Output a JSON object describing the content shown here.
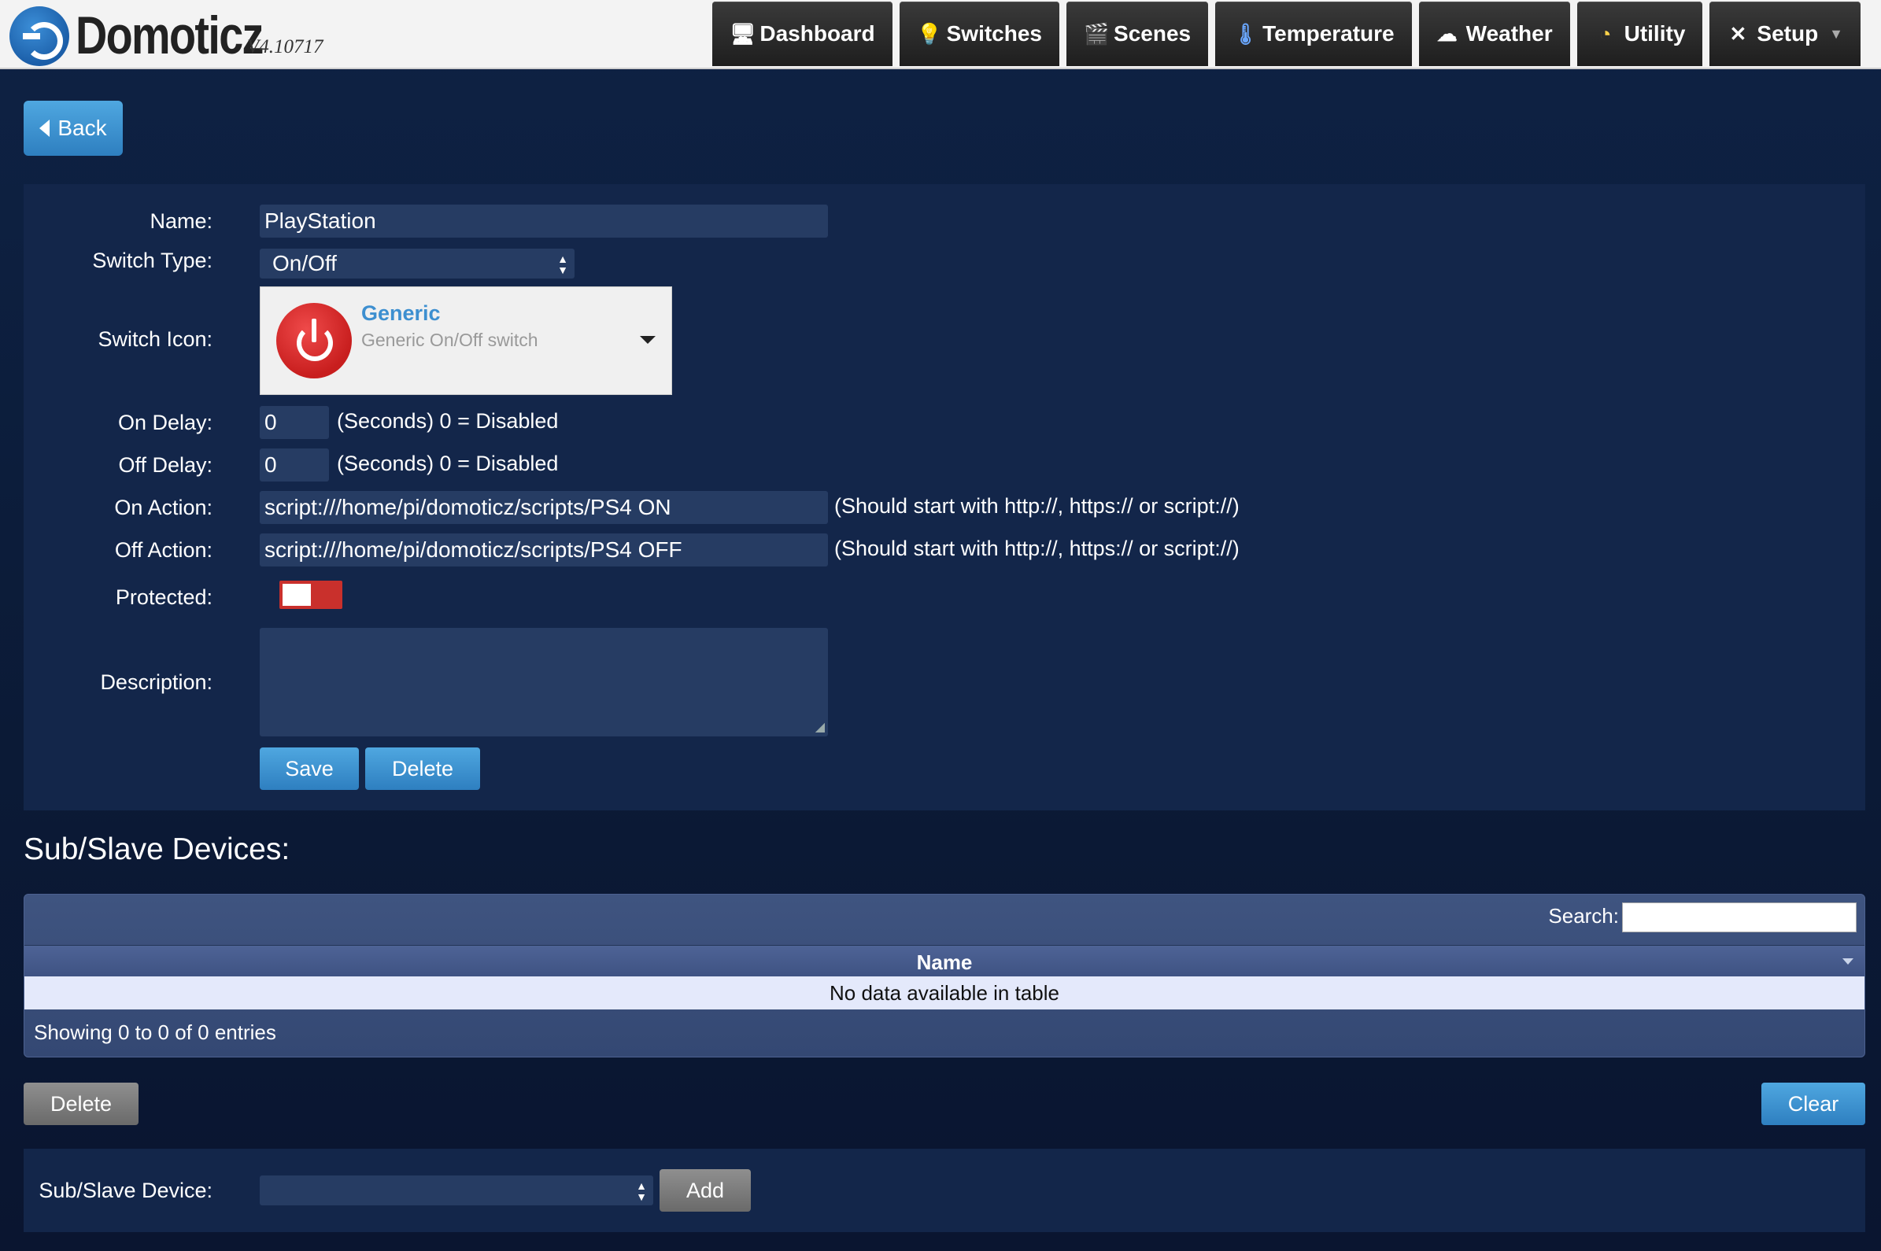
{
  "app": {
    "name": "Domoticz",
    "version": "V4.10717"
  },
  "nav": [
    {
      "label": "Dashboard",
      "icon": "monitor-icon"
    },
    {
      "label": "Switches",
      "icon": "bulb-icon"
    },
    {
      "label": "Scenes",
      "icon": "clapper-icon"
    },
    {
      "label": "Temperature",
      "icon": "thermometer-icon"
    },
    {
      "label": "Weather",
      "icon": "cloud-icon"
    },
    {
      "label": "Utility",
      "icon": "gauge-icon"
    },
    {
      "label": "Setup",
      "icon": "tools-icon"
    }
  ],
  "back_label": "Back",
  "form": {
    "name_label": "Name:",
    "name_value": "PlayStation",
    "switch_type_label": "Switch Type:",
    "switch_type_value": "On/Off",
    "switch_icon_label": "Switch Icon:",
    "icon_title": "Generic",
    "icon_subtitle": "Generic On/Off switch",
    "on_delay_label": "On Delay:",
    "on_delay_value": "0",
    "on_delay_hint": "(Seconds) 0 = Disabled",
    "off_delay_label": "Off Delay:",
    "off_delay_value": "0",
    "off_delay_hint": "(Seconds) 0 = Disabled",
    "on_action_label": "On Action:",
    "on_action_value": "script:///home/pi/domoticz/scripts/PS4 ON",
    "on_action_hint": "(Should start with http://, https:// or script://)",
    "off_action_label": "Off Action:",
    "off_action_value": "script:///home/pi/domoticz/scripts/PS4 OFF",
    "off_action_hint": "(Should start with http://, https:// or script://)",
    "protected_label": "Protected:",
    "protected_on": false,
    "description_label": "Description:",
    "description_value": "",
    "save_label": "Save",
    "delete_label": "Delete"
  },
  "colors": {
    "accent": "#3a8fd4",
    "toggle_off": "#c9302c",
    "panel": "#13264a"
  },
  "subslave": {
    "title": "Sub/Slave Devices:",
    "search_label": "Search:",
    "column": "Name",
    "empty_text": "No data available in table",
    "info_text": "Showing 0 to 0 of 0 entries",
    "delete_label": "Delete",
    "clear_label": "Clear",
    "device_label": "Sub/Slave Device:",
    "device_value": "",
    "add_label": "Add"
  }
}
